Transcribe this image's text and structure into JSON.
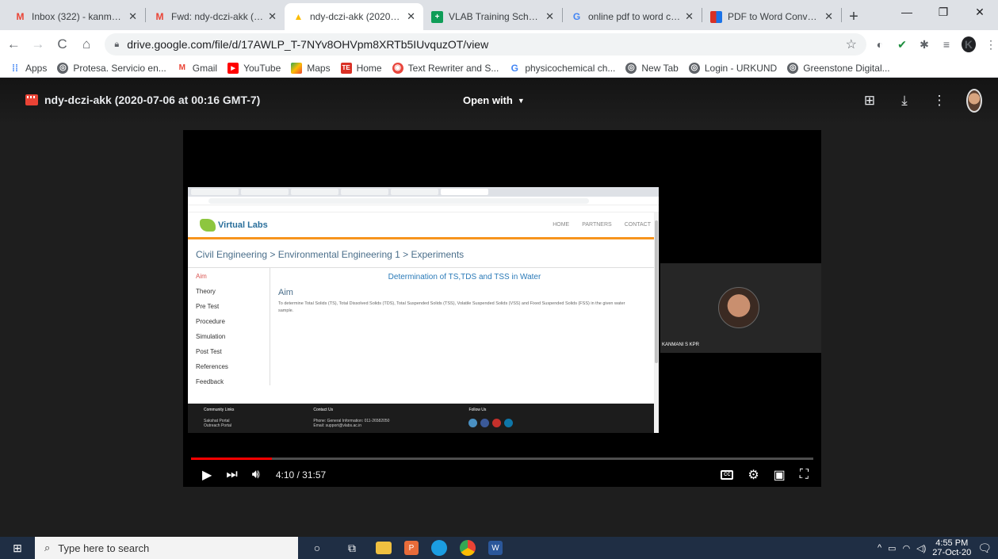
{
  "browser": {
    "tabs": [
      {
        "title": "Inbox (322) - kanmanisr",
        "icon": "gmail-icon",
        "color": "#ea4335"
      },
      {
        "title": "Fwd: ndy-dczi-akk (2020",
        "icon": "gmail-icon",
        "color": "#ea4335"
      },
      {
        "title": "ndy-dczi-akk (2020-07-",
        "icon": "drive-icon",
        "color": "#fbbc04",
        "active": true
      },
      {
        "title": "VLAB Training Schedule",
        "icon": "sheets-icon",
        "color": "#0f9d58"
      },
      {
        "title": "online pdf to word conv",
        "icon": "google-icon",
        "color": "#4285f4"
      },
      {
        "title": "PDF to Word Converter",
        "icon": "pdf-converter-icon",
        "color": "#d93025"
      }
    ],
    "url": "drive.google.com/file/d/17AWLP_T-7NYv8OHVpm8XRTb5IUvquzOT/view",
    "profile_initial": "K",
    "bookmarks": [
      {
        "label": "Apps",
        "icon": "apps-grid-icon",
        "color": "#4285f4"
      },
      {
        "label": "Protesa. Servicio en...",
        "icon": "globe-icon",
        "color": "#5f6368"
      },
      {
        "label": "Gmail",
        "icon": "gmail-icon",
        "color": "#ea4335"
      },
      {
        "label": "YouTube",
        "icon": "youtube-icon",
        "color": "#ff0000"
      },
      {
        "label": "Maps",
        "icon": "maps-icon",
        "color": "#34a853"
      },
      {
        "label": "Home",
        "icon": "te-icon",
        "color": "#d93025"
      },
      {
        "label": "Text Rewriter and S...",
        "icon": "rewriter-icon",
        "color": "#e8453c"
      },
      {
        "label": "physicochemical ch...",
        "icon": "google-icon",
        "color": "#4285f4"
      },
      {
        "label": "New Tab",
        "icon": "globe-icon",
        "color": "#5f6368"
      },
      {
        "label": "Login - URKUND",
        "icon": "globe-icon",
        "color": "#5f6368"
      },
      {
        "label": "Greenstone Digital...",
        "icon": "globe-icon",
        "color": "#5f6368"
      }
    ]
  },
  "viewer": {
    "file_title": "ndy-dczi-akk (2020-07-06 at 00:16 GMT-7)",
    "open_with": "Open with"
  },
  "video": {
    "time": "4:10 / 31:57",
    "progress_fraction": 0.13,
    "participant_name": "KANMANI S KPR",
    "inner_page": {
      "logo": "Virtual Labs",
      "nav": [
        "HOME",
        "PARTNERS",
        "CONTACT"
      ],
      "breadcrumb": "Civil Engineering > Environmental Engineering 1 > Experiments",
      "sidebar": [
        "Aim",
        "Theory",
        "Pre Test",
        "Procedure",
        "Simulation",
        "Post Test",
        "References",
        "Feedback"
      ],
      "experiment_title": "Determination of TS,TDS and TSS in Water",
      "aim_heading": "Aim",
      "aim_text": "To determine Total Solids (TS), Total Dissolved Solids (TDS), Total Suspended Solids (TSS), Volatile Suspended Solids (VSS) and Fixed Suspended Solids (FSS) in the given water sample.",
      "footer": {
        "community": "Community Links",
        "community_items": [
          "Sakshat Portal",
          "Outreach Portal"
        ],
        "contact": "Contact Us",
        "contact_items": [
          "Phone: General Information: 011-26582050",
          "Email: support@vlabs.ac.in"
        ],
        "follow": "Follow Us"
      }
    }
  },
  "taskbar": {
    "search_placeholder": "Type here to search",
    "time": "4:55 PM",
    "date": "27-Oct-20"
  }
}
